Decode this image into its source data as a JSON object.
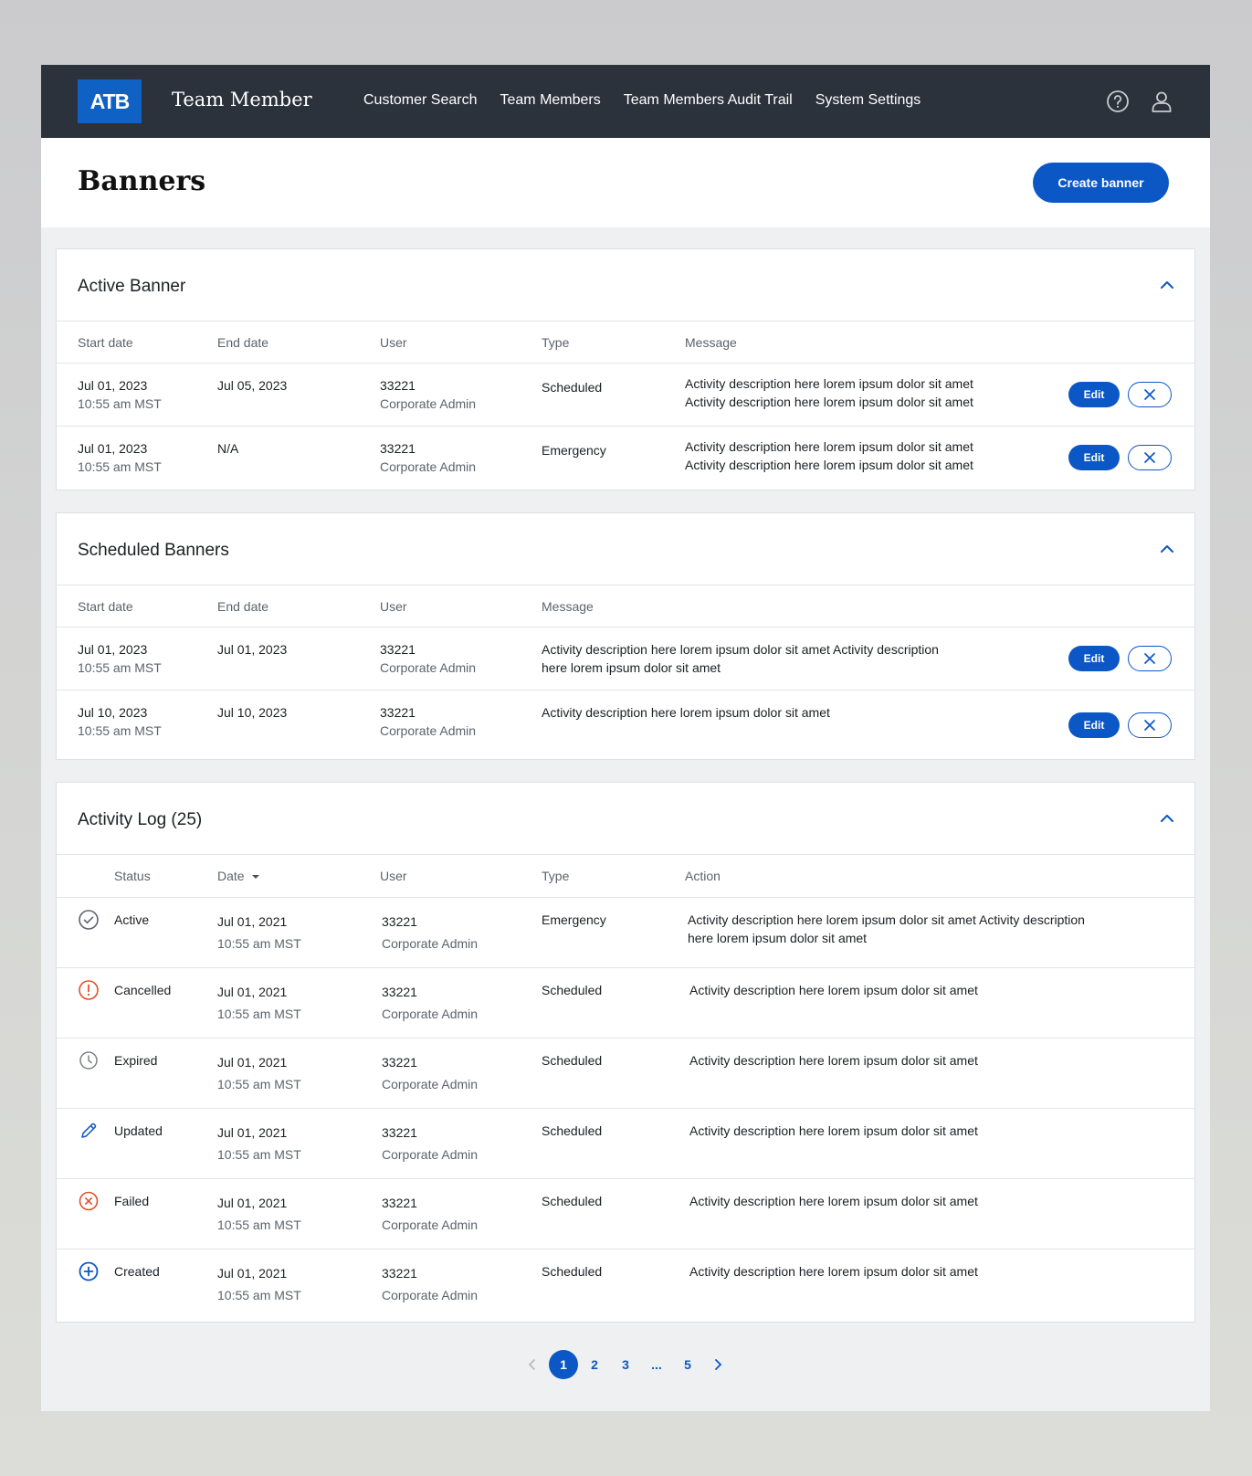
{
  "nav": {
    "logo": "ATB",
    "app_name": "Team Member",
    "links": [
      "Customer Search",
      "Team Members",
      "Team Members Audit Trail",
      "System Settings"
    ],
    "icons": [
      "help-icon",
      "user-icon"
    ]
  },
  "page": {
    "title": "Banners",
    "create_label": "Create banner"
  },
  "active": {
    "title": "Active Banner",
    "headers": [
      "Start date",
      "End date",
      "User",
      "Type",
      "Message"
    ],
    "rows": [
      {
        "start": "Jul 01, 2023",
        "start_time": "10:55 am MST",
        "end": "Jul 05, 2023",
        "user": "33221",
        "role": "Corporate Admin",
        "type": "Scheduled",
        "message1": "Activity description here lorem ipsum dolor sit amet",
        "message2": "Activity description here lorem ipsum dolor sit amet",
        "edit": "Edit"
      },
      {
        "start": "Jul 01, 2023",
        "start_time": "10:55 am MST",
        "end": "N/A",
        "user": "33221",
        "role": "Corporate Admin",
        "type": "Emergency",
        "message1": "Activity description here lorem ipsum dolor sit amet",
        "message2": "Activity description here lorem ipsum dolor sit amet",
        "edit": "Edit"
      }
    ]
  },
  "scheduled": {
    "title": "Scheduled Banners",
    "headers": [
      "Start date",
      "End date",
      "User",
      "Message"
    ],
    "rows": [
      {
        "start": "Jul 01, 2023",
        "start_time": "10:55 am MST",
        "end": "Jul 01, 2023",
        "user": "33221",
        "role": "Corporate Admin",
        "message1": "Activity description here lorem ipsum dolor sit amet Activity description",
        "message2": "here lorem ipsum dolor sit amet",
        "edit": "Edit"
      },
      {
        "start": "Jul 10, 2023",
        "start_time": "10:55 am MST",
        "end": "Jul 10, 2023",
        "user": "33221",
        "role": "Corporate Admin",
        "message1": "Activity description here lorem ipsum dolor sit amet",
        "message2": "",
        "edit": "Edit"
      }
    ]
  },
  "activity": {
    "title": "Activity Log (25)",
    "headers": [
      "Status",
      "Date",
      "User",
      "Type",
      "Action"
    ],
    "rows": [
      {
        "status": "Active",
        "icon": "check-circle-icon",
        "date": "Jul 01, 2021",
        "time": "10:55 am MST",
        "user": "33221",
        "role": "Corporate Admin",
        "type": "Emergency",
        "action1": "Activity description here lorem ipsum dolor sit amet Activity description",
        "action2": "here lorem ipsum dolor sit amet"
      },
      {
        "status": "Cancelled",
        "icon": "alert-circle-icon",
        "date": "Jul 01, 2021",
        "time": "10:55 am MST",
        "user": "33221",
        "role": "Corporate Admin",
        "type": "Scheduled",
        "action1": "Activity description here lorem ipsum dolor sit amet",
        "action2": ""
      },
      {
        "status": "Expired",
        "icon": "clock-icon",
        "date": "Jul 01, 2021",
        "time": "10:55 am MST",
        "user": "33221",
        "role": "Corporate Admin",
        "type": "Scheduled",
        "action1": "Activity description here lorem ipsum dolor sit amet",
        "action2": ""
      },
      {
        "status": "Updated",
        "icon": "pencil-icon",
        "date": "Jul 01, 2021",
        "time": "10:55 am MST",
        "user": "33221",
        "role": "Corporate Admin",
        "type": "Scheduled",
        "action1": "Activity description here lorem ipsum dolor sit amet",
        "action2": ""
      },
      {
        "status": "Failed",
        "icon": "x-circle-icon",
        "date": "Jul 01, 2021",
        "time": "10:55 am MST",
        "user": "33221",
        "role": "Corporate Admin",
        "type": "Scheduled",
        "action1": "Activity description here lorem ipsum dolor sit amet",
        "action2": ""
      },
      {
        "status": "Created",
        "icon": "plus-circle-icon",
        "date": "Jul 01, 2021",
        "time": "10:55 am MST",
        "user": "33221",
        "role": "Corporate Admin",
        "type": "Scheduled",
        "action1": "Activity description here lorem ipsum dolor sit amet",
        "action2": ""
      }
    ]
  },
  "pagination": {
    "pages": [
      "1",
      "2",
      "3",
      "...",
      "5"
    ],
    "current": "1"
  },
  "colors": {
    "brand": "#0b57c6",
    "nav_bg": "#2b323b",
    "warning": "#e0502a"
  }
}
